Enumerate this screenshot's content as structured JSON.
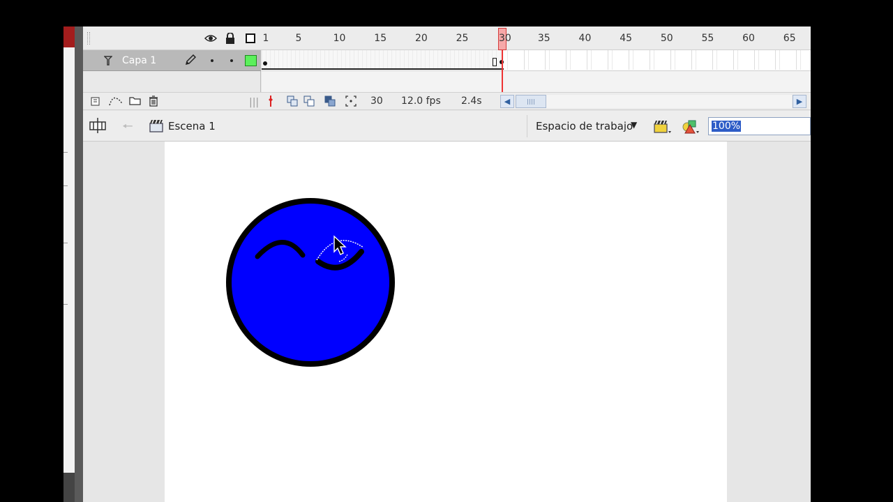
{
  "timeline": {
    "frame_numbers": [
      "1",
      "5",
      "10",
      "15",
      "20",
      "25",
      "30",
      "35",
      "40",
      "45",
      "50",
      "55",
      "60",
      "65"
    ],
    "current_frame_label": "30",
    "layer": {
      "name": "Capa 1",
      "color": "#5cf05c"
    },
    "footer": {
      "current_frame": "30",
      "frame_rate": "12.0 fps",
      "elapsed_time": "2.4s"
    }
  },
  "edit_bar": {
    "scene_name": "Escena 1",
    "workspace_label": "Espacio de trabajo",
    "zoom_value": "100%"
  },
  "canvas": {
    "face_fill": "#0000ff",
    "outline_color": "#000000"
  },
  "icons": {
    "visibility": "eye-icon",
    "lock": "lock-icon",
    "outline": "outline-square-icon",
    "layer": "layer-icon",
    "pencil": "pencil-icon",
    "cursor": "arrow-cursor-icon"
  }
}
